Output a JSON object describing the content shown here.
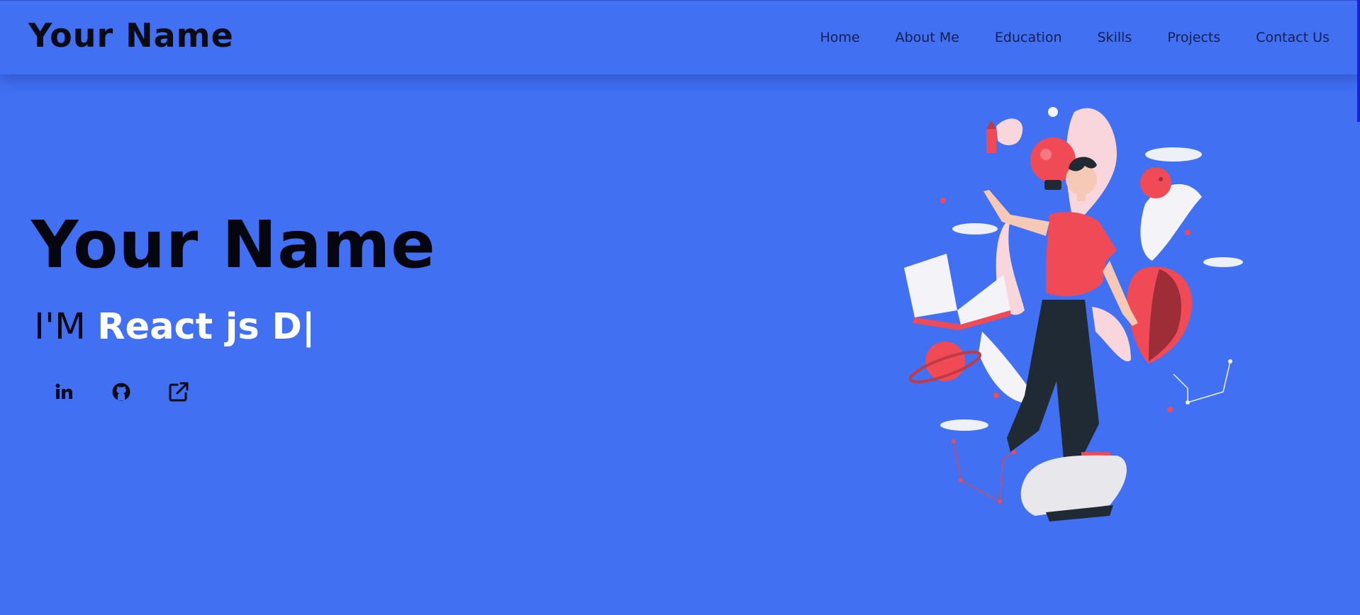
{
  "navbar": {
    "brand": "Your Name",
    "links": [
      {
        "label": "Home"
      },
      {
        "label": "About Me"
      },
      {
        "label": "Education"
      },
      {
        "label": "Skills"
      },
      {
        "label": "Projects"
      },
      {
        "label": "Contact Us"
      }
    ]
  },
  "hero": {
    "name": "Your Name",
    "role_prefix": "I'M ",
    "role_typed": "React js D",
    "cursor": "|",
    "socials": [
      {
        "icon": "linkedin-icon"
      },
      {
        "icon": "github-icon"
      },
      {
        "icon": "external-link-icon"
      }
    ]
  },
  "colors": {
    "background": "#4170f3",
    "text_dark": "#0b0b16",
    "text_light": "#ffffff",
    "accent_red": "#f04a56"
  }
}
